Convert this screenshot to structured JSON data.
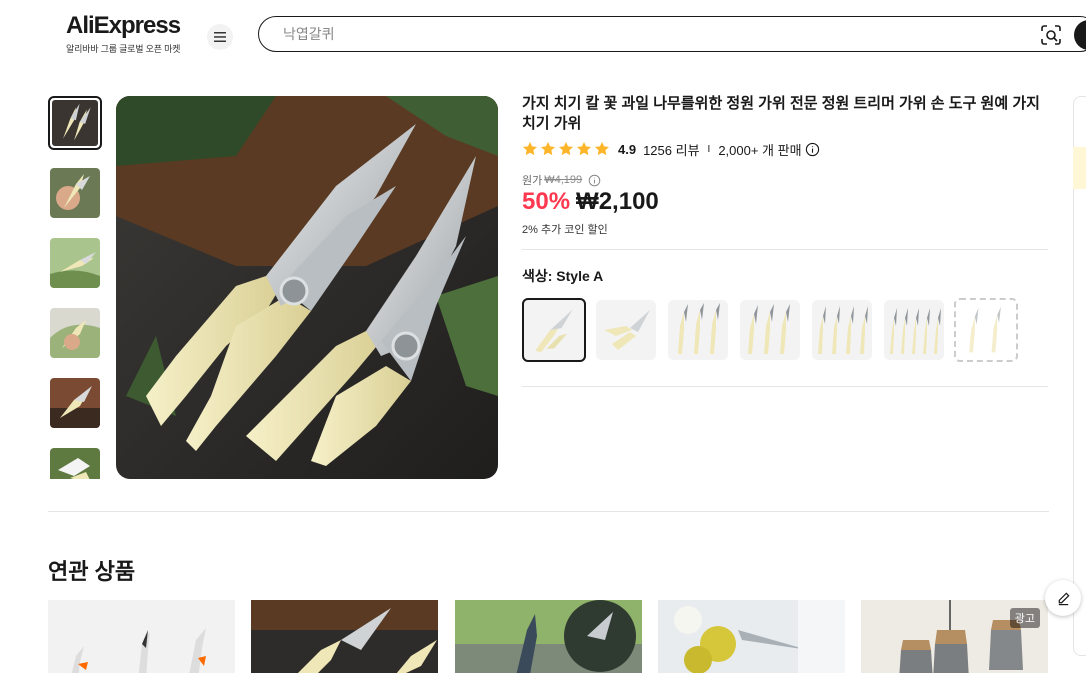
{
  "header": {
    "logo_text": "AliExpress",
    "logo_subtitle": "알리바바 그룹 글로벌 오픈 마켓",
    "menu_icon": "hamburger-icon",
    "search_placeholder": "낙엽갈퀴",
    "camera_icon": "image-search-icon"
  },
  "gallery": {
    "thumbnails": [
      "thumb-1",
      "thumb-2",
      "thumb-3",
      "thumb-4",
      "thumb-5",
      "thumb-6"
    ],
    "selected_index": 0
  },
  "product": {
    "title": "가지 치기 칼 꽃 과일 나무를위한 정원 가위 전문 정원 트리머 가위 손 도구 원예 가지 치기 가위",
    "rating_stars": 5,
    "rating": "4.9",
    "reviews": "1256 리뷰",
    "separator": "I",
    "sold": "2,000+ 개 판매",
    "original_price_label": "원가",
    "original_price": "₩4,199",
    "discount": "50%",
    "price": "₩2,100",
    "coin_note": "2% 추가 코인 할인",
    "color_label": "색상: Style A",
    "swatch_count": 7,
    "selected_swatch": 0
  },
  "related": {
    "title": "연관 상품",
    "ad_badge": "광고"
  },
  "colors": {
    "discount_red": "#fd384f",
    "text": "#191919",
    "handle_cream": "#efe7b8"
  }
}
